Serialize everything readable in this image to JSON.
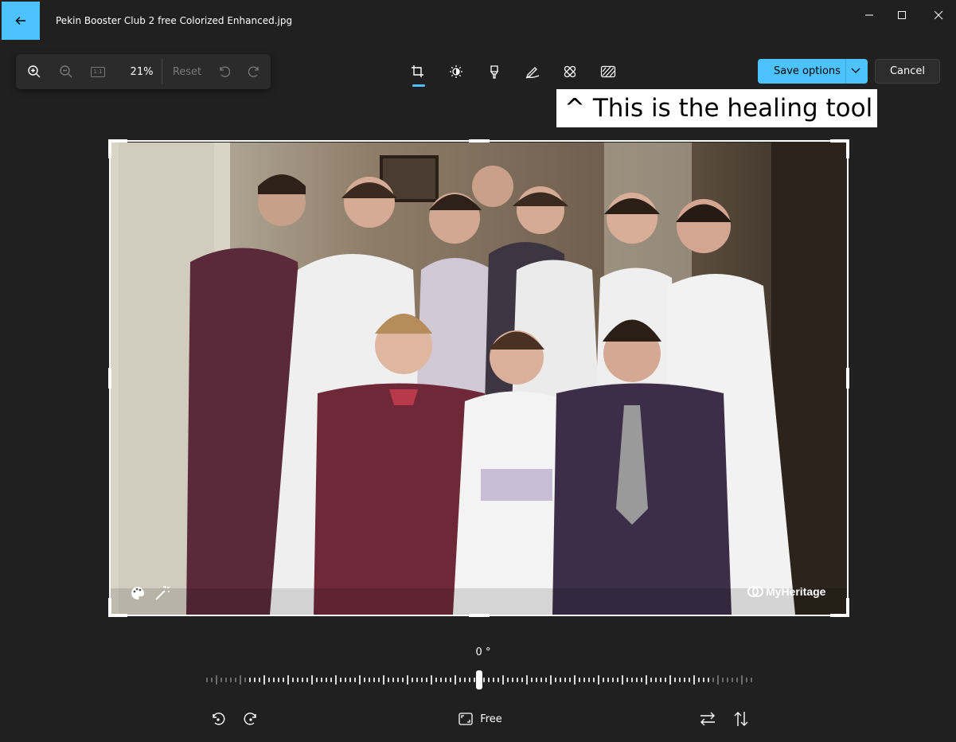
{
  "window": {
    "title": "Pekin Booster Club 2 free Colorized Enhanced.jpg",
    "back_icon": "arrow-left-icon",
    "controls": [
      "minimize-icon",
      "maximize-icon",
      "close-icon"
    ]
  },
  "zoom_panel": {
    "zoom_in_icon": "zoom-in-icon",
    "zoom_out_icon": "zoom-out-icon",
    "actual_size_icon": "actual-size-icon",
    "actual_size_glyph": "1:1",
    "zoom_value": "21%",
    "reset_label": "Reset",
    "undo_icon": "undo-icon",
    "redo_icon": "redo-icon"
  },
  "tools": [
    {
      "name": "crop",
      "icon": "crop-icon",
      "active": true
    },
    {
      "name": "adjust",
      "icon": "brightness-icon",
      "active": false
    },
    {
      "name": "filter",
      "icon": "filter-icon",
      "active": false
    },
    {
      "name": "markup",
      "icon": "pen-icon",
      "active": false
    },
    {
      "name": "retouch",
      "icon": "healing-icon",
      "active": false
    },
    {
      "name": "background",
      "icon": "background-blur-icon",
      "active": false
    }
  ],
  "actions": {
    "save_label": "Save options",
    "cancel_label": "Cancel"
  },
  "annotation": {
    "text": "^ This is the healing tool"
  },
  "image_overlay": {
    "palette_icon": "palette-icon",
    "magic_wand_icon": "magic-wand-icon",
    "watermark": "MyHeritage"
  },
  "straighten": {
    "angle_label": "0 °",
    "angle_value": 0
  },
  "bottom_bar": {
    "rotate_left_icon": "rotate-left-icon",
    "rotate_right_icon": "rotate-right-icon",
    "aspect_icon": "aspect-ratio-icon",
    "aspect_label": "Free",
    "flip_horizontal_icon": "flip-horizontal-icon",
    "flip_vertical_icon": "flip-vertical-icon"
  },
  "colors": {
    "accent": "#4cc2ff",
    "background": "#202020",
    "panel": "#2b2b2b"
  }
}
